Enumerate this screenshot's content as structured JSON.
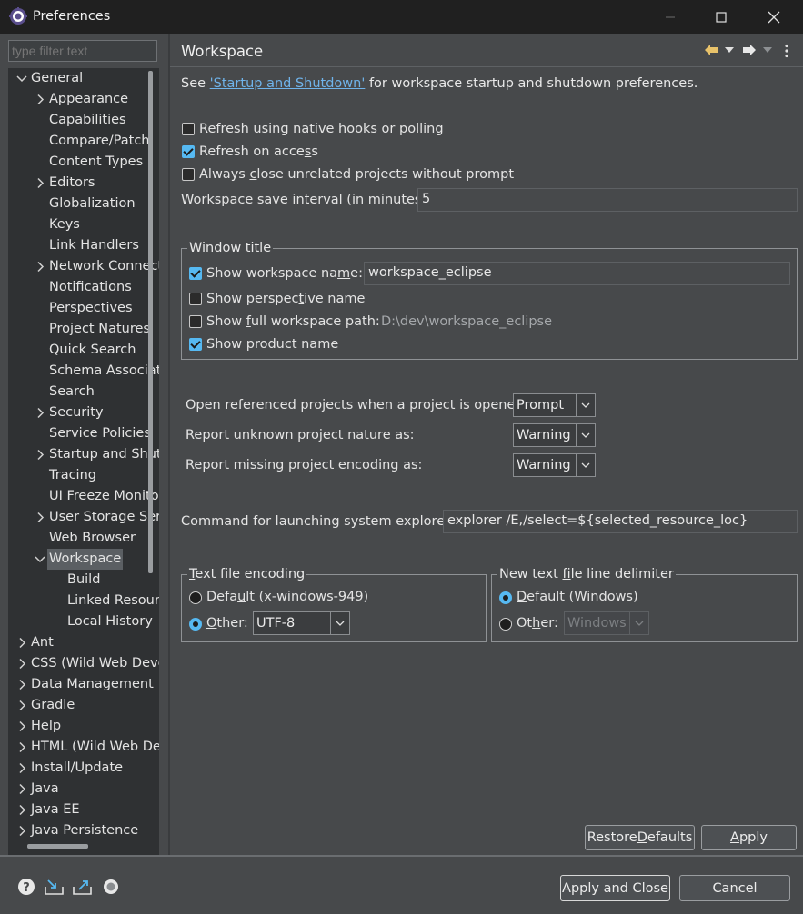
{
  "window": {
    "title": "Preferences",
    "minimize": "—",
    "maximize": "☐",
    "close": "✕"
  },
  "filter": {
    "placeholder": "type filter text"
  },
  "tree": [
    {
      "label": "General",
      "level": 0,
      "chev": "down"
    },
    {
      "label": "Appearance",
      "level": 1,
      "chev": "right"
    },
    {
      "label": "Capabilities",
      "level": 1,
      "chev": ""
    },
    {
      "label": "Compare/Patch",
      "level": 1,
      "chev": ""
    },
    {
      "label": "Content Types",
      "level": 1,
      "chev": ""
    },
    {
      "label": "Editors",
      "level": 1,
      "chev": "right"
    },
    {
      "label": "Globalization",
      "level": 1,
      "chev": ""
    },
    {
      "label": "Keys",
      "level": 1,
      "chev": ""
    },
    {
      "label": "Link Handlers",
      "level": 1,
      "chev": ""
    },
    {
      "label": "Network Connections",
      "level": 1,
      "chev": "right"
    },
    {
      "label": "Notifications",
      "level": 1,
      "chev": ""
    },
    {
      "label": "Perspectives",
      "level": 1,
      "chev": ""
    },
    {
      "label": "Project Natures",
      "level": 1,
      "chev": ""
    },
    {
      "label": "Quick Search",
      "level": 1,
      "chev": ""
    },
    {
      "label": "Schema Associations",
      "level": 1,
      "chev": ""
    },
    {
      "label": "Search",
      "level": 1,
      "chev": ""
    },
    {
      "label": "Security",
      "level": 1,
      "chev": "right"
    },
    {
      "label": "Service Policies",
      "level": 1,
      "chev": ""
    },
    {
      "label": "Startup and Shutdown",
      "level": 1,
      "chev": "right"
    },
    {
      "label": "Tracing",
      "level": 1,
      "chev": ""
    },
    {
      "label": "UI Freeze Monitoring",
      "level": 1,
      "chev": ""
    },
    {
      "label": "User Storage Service",
      "level": 1,
      "chev": "right"
    },
    {
      "label": "Web Browser",
      "level": 1,
      "chev": ""
    },
    {
      "label": "Workspace",
      "level": 1,
      "chev": "down",
      "selected": true
    },
    {
      "label": "Build",
      "level": 2,
      "chev": ""
    },
    {
      "label": "Linked Resources",
      "level": 2,
      "chev": ""
    },
    {
      "label": "Local History",
      "level": 2,
      "chev": ""
    },
    {
      "label": "Ant",
      "level": 0,
      "chev": "right"
    },
    {
      "label": "CSS (Wild Web Developer)",
      "level": 0,
      "chev": "right"
    },
    {
      "label": "Data Management",
      "level": 0,
      "chev": "right"
    },
    {
      "label": "Gradle",
      "level": 0,
      "chev": "right"
    },
    {
      "label": "Help",
      "level": 0,
      "chev": "right"
    },
    {
      "label": "HTML (Wild Web Developer)",
      "level": 0,
      "chev": "right"
    },
    {
      "label": "Install/Update",
      "level": 0,
      "chev": "right"
    },
    {
      "label": "Java",
      "level": 0,
      "chev": "right"
    },
    {
      "label": "Java EE",
      "level": 0,
      "chev": "right"
    },
    {
      "label": "Java Persistence",
      "level": 0,
      "chev": "right"
    }
  ],
  "page": {
    "title": "Workspace",
    "see_prefix": "See ",
    "see_link": "'Startup and Shutdown'",
    "see_suffix": " for workspace startup and shutdown preferences."
  },
  "options": {
    "refresh_native": {
      "label_u": "R",
      "label_rest": "efresh using native hooks or polling",
      "checked": false
    },
    "refresh_access": {
      "label_a": "Refresh on acce",
      "label_u": "s",
      "label_b": "s",
      "checked": true
    },
    "always_close": {
      "label_a": "Always ",
      "label_u": "c",
      "label_b": "lose unrelated projects without prompt",
      "checked": false
    },
    "save_interval": {
      "label": "Workspace save interval (in minutes):",
      "value": "5"
    }
  },
  "window_title": {
    "group": "Window title",
    "show_workspace_name": {
      "label_a": "Show workspace na",
      "label_u": "m",
      "label_b": "e:",
      "checked": true,
      "value": "workspace_eclipse"
    },
    "show_perspective_name": {
      "label_a": "Show perspec",
      "label_u": "t",
      "label_b": "ive name",
      "checked": false
    },
    "show_full_path": {
      "label_a": "Show ",
      "label_u": "f",
      "label_b": "ull workspace path:",
      "checked": false,
      "value": "D:\\dev\\workspace_eclipse"
    },
    "show_product_name": {
      "label": "Show product name",
      "checked": true
    }
  },
  "prompts": {
    "open_referenced": {
      "label": "Open referenced projects when a project is opened:",
      "value": "Prompt"
    },
    "unknown_nature": {
      "label": "Report unknown project nature as:",
      "value": "Warning"
    },
    "missing_encoding": {
      "label": "Report missing project encoding as:",
      "value": "Warning"
    }
  },
  "explorer": {
    "label": "Command for launching system explorer:",
    "value": "explorer /E,/select=${selected_resource_loc}"
  },
  "encoding": {
    "group_u": "T",
    "group_rest": "ext file encoding",
    "default": {
      "label_a": "Defa",
      "label_u": "u",
      "label_b": "lt (x-windows-949)",
      "checked": false
    },
    "other": {
      "label_u": "O",
      "label_rest": "ther:",
      "checked": true,
      "value": "UTF-8"
    }
  },
  "delimiter": {
    "group_a": "New text ",
    "group_u": "f",
    "group_b": "ile line delimiter",
    "default": {
      "label_u": "D",
      "label_rest": "efault (Windows)",
      "checked": true
    },
    "other": {
      "label_a": "Ot",
      "label_u": "h",
      "label_b": "er:",
      "checked": false,
      "value": "Windows"
    }
  },
  "buttons": {
    "restore_a": "Restore ",
    "restore_u": "D",
    "restore_b": "efaults",
    "apply_u": "A",
    "apply_rest": "pply",
    "apply_close": "Apply and Close",
    "cancel": "Cancel"
  },
  "colors": {
    "accent": "#56b9f2",
    "link": "#6fb3ea",
    "background": "#47494b",
    "tree_bg": "#2f3133"
  }
}
